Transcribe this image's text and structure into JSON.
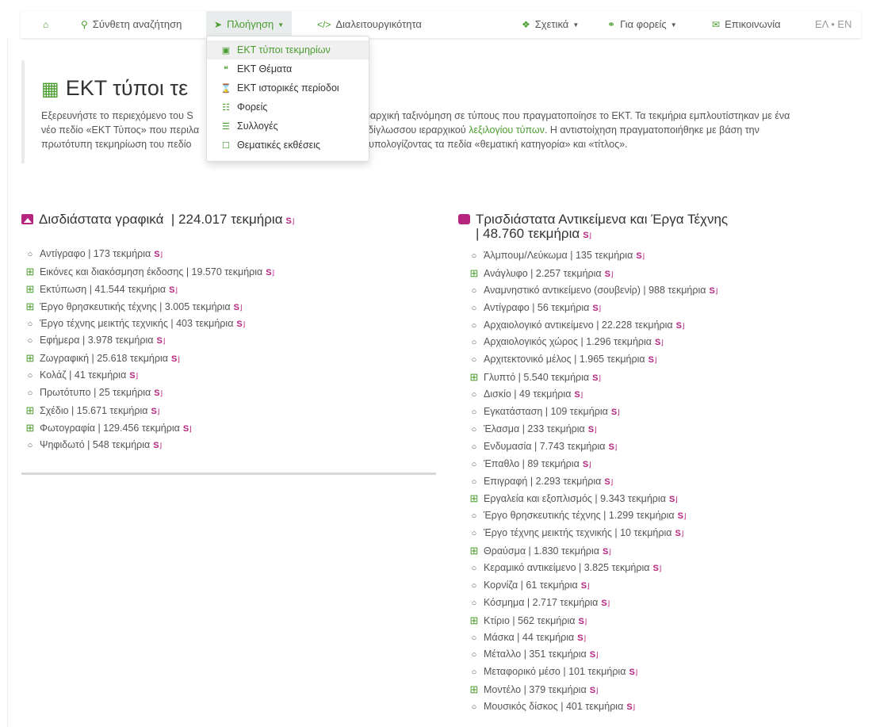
{
  "nav": {
    "home_icon": "home-icon",
    "items": [
      {
        "label": "Σύνθετη αναζήτηση",
        "icon": "search-icon"
      },
      {
        "label": "Πλοήγηση",
        "icon": "location-arrow-icon"
      },
      {
        "label": "Διαλειτουργικότητα",
        "icon": "code-icon"
      },
      {
        "label": "Σχετικά",
        "icon": "info-icon"
      },
      {
        "label": "Για φορείς",
        "icon": "handshake-icon"
      },
      {
        "label": "Επικοινωνία",
        "icon": "envelope-icon"
      }
    ],
    "lang": "ΕΛ • ΕΝ"
  },
  "dropdown": {
    "items": [
      {
        "label": "ΕΚΤ τύποι τεκμηρίων",
        "icon": "sitemap-icon",
        "selected": true
      },
      {
        "label": "ΕΚΤ Θέματα",
        "icon": "quote-icon"
      },
      {
        "label": "ΕΚΤ ιστορικές περίοδοι",
        "icon": "hourglass-icon"
      },
      {
        "label": "Φορείς",
        "icon": "institution-icon"
      },
      {
        "label": "Συλλογές",
        "icon": "database-icon"
      },
      {
        "label": "Θεματικές εκθέσεις",
        "icon": "bookmark-icon"
      }
    ]
  },
  "header": {
    "title": "ΕΚΤ τύποι τε",
    "intro_1": "Εξερευνήστε το περιεχόμενο του S",
    "intro_2": "ν ιεραρχική ταξινόμηση σε τύπους που πραγματοποίησε το ΕΚΤ. Τα τεκμήρια εμπλουτίστηκαν με ένα",
    "intro_3": "νέο πεδίο «ΕΚΤ Τύπος» που περιλα",
    "intro_4": "δίγλωσσου ιεραρχικού ",
    "intro_link": "λεξιλογίου τύπων",
    "intro_5": ". Η αντιστοίχηση πραγματοποιήθηκε με βάση την",
    "intro_6": "πρωτότυπη τεκμηρίωση του πεδίο",
    "intro_7": "ύσεις, συνυπολογίζοντας τα πεδία «θεματική κατηγορία» και «τίτλος»."
  },
  "left_section": {
    "title": "Δισδιάστατα γραφικά",
    "count": "| 224.017 τεκμήρια",
    "items": [
      {
        "label": "Αντίγραφο | 173 τεκμήρια",
        "expandable": false
      },
      {
        "label": "Εικόνες και διακόσμηση έκδοσης | 19.570 τεκμήρια",
        "expandable": true
      },
      {
        "label": "Εκτύπωση | 41.544 τεκμήρια",
        "expandable": true
      },
      {
        "label": "Έργο θρησκευτικής τέχνης | 3.005 τεκμήρια",
        "expandable": true
      },
      {
        "label": "Έργο τέχνης μεικτής τεχνικής | 403 τεκμήρια",
        "expandable": false
      },
      {
        "label": "Εφήμερα | 3.978 τεκμήρια",
        "expandable": false
      },
      {
        "label": "Ζωγραφική | 25.618 τεκμήρια",
        "expandable": true
      },
      {
        "label": "Κολάζ | 41 τεκμήρια",
        "expandable": false
      },
      {
        "label": "Πρωτότυπο | 25 τεκμήρια",
        "expandable": false
      },
      {
        "label": "Σχέδιο | 15.671 τεκμήρια",
        "expandable": true
      },
      {
        "label": "Φωτογραφία | 129.456 τεκμήρια",
        "expandable": true
      },
      {
        "label": "Ψηφιδωτό | 548 τεκμήρια",
        "expandable": false
      }
    ]
  },
  "right_section": {
    "title": "Τρισδιάστατα Αντικείμενα και Έργα Τέχνης",
    "count": "| 48.760 τεκμήρια",
    "items": [
      {
        "label": "Άλμπουμ/Λεύκωμα | 135 τεκμήρια",
        "expandable": false
      },
      {
        "label": "Ανάγλυφο | 2.257 τεκμήρια",
        "expandable": true
      },
      {
        "label": "Αναμνηστικό αντικείμενο (σουβενίρ) | 988 τεκμήρια",
        "expandable": false
      },
      {
        "label": "Αντίγραφο | 56 τεκμήρια",
        "expandable": false
      },
      {
        "label": "Αρχαιολογικό αντικείμενο | 22.228 τεκμήρια",
        "expandable": false
      },
      {
        "label": "Αρχαιολογικός χώρος | 1.296 τεκμήρια",
        "expandable": false
      },
      {
        "label": "Αρχιτεκτονικό μέλος | 1.965 τεκμήρια",
        "expandable": false
      },
      {
        "label": "Γλυπτό | 5.540 τεκμήρια",
        "expandable": true
      },
      {
        "label": "Δισκίο | 49 τεκμήρια",
        "expandable": false
      },
      {
        "label": "Εγκατάσταση | 109 τεκμήρια",
        "expandable": false
      },
      {
        "label": "Έλασμα | 233 τεκμήρια",
        "expandable": false
      },
      {
        "label": "Ενδυμασία | 7.743 τεκμήρια",
        "expandable": false
      },
      {
        "label": "Έπαθλο | 89 τεκμήρια",
        "expandable": false
      },
      {
        "label": "Επιγραφή | 2.293 τεκμήρια",
        "expandable": false
      },
      {
        "label": "Εργαλεία και εξοπλισμός | 9.343 τεκμήρια",
        "expandable": true
      },
      {
        "label": "Έργο θρησκευτικής τέχνης | 1.299 τεκμήρια",
        "expandable": false
      },
      {
        "label": "Έργο τέχνης μεικτής τεχνικής | 10 τεκμήρια",
        "expandable": false
      },
      {
        "label": "Θραύσμα | 1.830 τεκμήρια",
        "expandable": true
      },
      {
        "label": "Κεραμικό αντικείμενο | 3.825 τεκμήρια",
        "expandable": false
      },
      {
        "label": "Κορνίζα | 61 τεκμήρια",
        "expandable": false
      },
      {
        "label": "Κόσμημα | 2.717 τεκμήρια",
        "expandable": false
      },
      {
        "label": "Κτίριο | 562 τεκμήρια",
        "expandable": true
      },
      {
        "label": "Μάσκα | 44 τεκμήρια",
        "expandable": false
      },
      {
        "label": "Μέταλλο | 351 τεκμήρια",
        "expandable": false
      },
      {
        "label": "Μεταφορικό μέσο | 101 τεκμήρια",
        "expandable": false
      },
      {
        "label": "Μοντέλο | 379 τεκμήρια",
        "expandable": true
      },
      {
        "label": "Μουσικός δίσκος | 401 τεκμήρια",
        "expandable": false
      }
    ]
  },
  "search_logo_text": "S",
  "colors": {
    "accent": "#4a9c2f",
    "brand": "#b5247f"
  }
}
